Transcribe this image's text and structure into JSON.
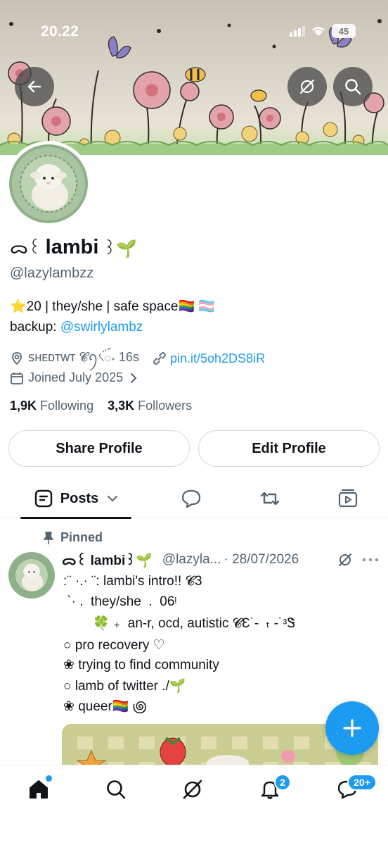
{
  "status_bar": {
    "time": "20.22",
    "battery": "45"
  },
  "profile": {
    "name_prefix": "ᯅ꒰",
    "name": "lambi",
    "name_suffix": "꒱🌱",
    "handle": "@lazylambzz",
    "bio_line1": "⭐20 | they/she | safe space🏳️‍🌈 🏳️‍⚧️",
    "bio_line2_prefix": "backup: ",
    "bio_line2_link": "@swirlylambz",
    "location": "ꜱʜᴇᴅᴛᴡᴛ 𝓒ꪆ৻ꪾ˖ 16s",
    "website": "pin.it/5oh2DS8iR",
    "joined": "Joined July 2025",
    "following_count": "1,9K",
    "following_label": "Following",
    "followers_count": "3,3K",
    "followers_label": "Followers"
  },
  "buttons": {
    "share": "Share Profile",
    "edit": "Edit Profile"
  },
  "tabs": {
    "posts": "Posts"
  },
  "post": {
    "pinned_label": "Pinned",
    "name": "ᯅ꒰ lambi꒱🌱",
    "handle": "@lazyla...",
    "date": "· 28/07/2026",
    "lines": [
      ":¨ ·.· ¨:  lambi's intro!! 𝓒3",
      " `· .  they/she  .  06ᵎ",
      "        🍀 ₊  an-r, ocd, autistic 𝓒Ɛ˙-  ₜ -˙ᵌᏕ",
      "○ pro recovery ♡",
      "❀ trying to find community",
      "○ lamb of twitter ./🌱",
      "❀ queer🏳️‍🌈 ౷"
    ]
  },
  "nav": {
    "notifications_badge": "2",
    "messages_badge": "20+"
  },
  "colors": {
    "accent": "#1d9bf0",
    "text": "#0f1419",
    "muted": "#536471"
  },
  "icons": [
    "back-arrow-icon",
    "grok-icon",
    "search-icon",
    "calendar-icon",
    "location-icon",
    "link-icon",
    "chevron-right-icon",
    "pin-icon",
    "home-icon",
    "bell-icon",
    "mail-icon",
    "plus-icon"
  ]
}
